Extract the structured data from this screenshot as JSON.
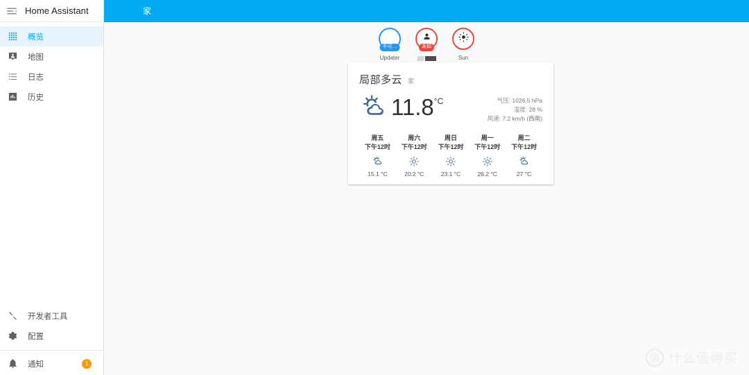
{
  "app": {
    "name": "Home Assistant",
    "menu_icon": "menu-open-icon"
  },
  "sidebar": {
    "items": [
      {
        "label": "概览",
        "icon": "view-dashboard-icon",
        "active": true
      },
      {
        "label": "地图",
        "icon": "map-marker-account-icon",
        "active": false
      },
      {
        "label": "日志",
        "icon": "format-list-bulleted-icon",
        "active": false
      },
      {
        "label": "历史",
        "icon": "chart-box-icon",
        "active": false
      }
    ],
    "bottom_items": [
      {
        "label": "开发者工具",
        "icon": "hammer-wrench-icon"
      },
      {
        "label": "配置",
        "icon": "cog-icon"
      }
    ],
    "notifications": {
      "label": "通知",
      "icon": "bell-icon",
      "count": "1",
      "badge_color": "#ff9800"
    }
  },
  "topbar": {
    "tab_label": "家",
    "background": "#03a9f4"
  },
  "badges": [
    {
      "name": "Updater",
      "state_label": "不可…",
      "icon": "blank-icon",
      "ring_color": "#2196f3",
      "chip_color": "#2196f3",
      "redacted": false
    },
    {
      "name": "",
      "state_label": "未知",
      "icon": "account-icon",
      "ring_color": "#f44336",
      "chip_color": "#f44336",
      "redacted": true
    },
    {
      "name": "Sun",
      "state_label": "",
      "icon": "sun-icon",
      "ring_color": "#f44336",
      "chip_color": "",
      "redacted": false
    }
  ],
  "weather_card": {
    "condition": "局部多云",
    "location": "家",
    "icon": "weather-partly-cloudy-icon",
    "temperature": "11.8",
    "unit": "°C",
    "attributes": [
      {
        "label": "气压:",
        "value": "1026.5 hPa"
      },
      {
        "label": "湿度:",
        "value": "28 %"
      },
      {
        "label": "风速:",
        "value": "7.2 km/h (西南)"
      }
    ],
    "forecast": [
      {
        "day": "周五",
        "time": "下午12时",
        "icon": "weather-partly-cloudy-icon",
        "temp": "15.1 °C"
      },
      {
        "day": "周六",
        "time": "下午12时",
        "icon": "weather-sunny-icon",
        "temp": "20.2 °C"
      },
      {
        "day": "周日",
        "time": "下午12时",
        "icon": "weather-sunny-icon",
        "temp": "23.1 °C"
      },
      {
        "day": "周一",
        "time": "下午12时",
        "icon": "weather-sunny-icon",
        "temp": "26.2 °C"
      },
      {
        "day": "周二",
        "time": "下午12时",
        "icon": "weather-partly-cloudy-icon",
        "temp": "27 °C"
      }
    ]
  },
  "watermark": {
    "logo": "值",
    "text": "什么值得买"
  }
}
